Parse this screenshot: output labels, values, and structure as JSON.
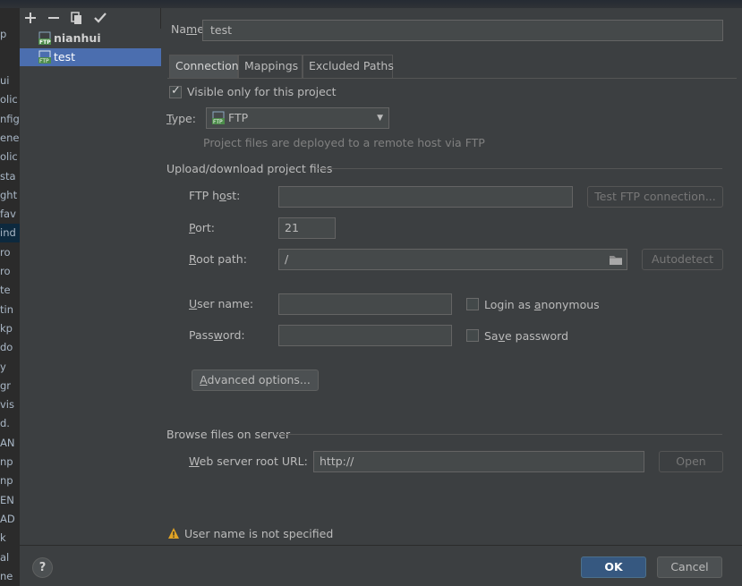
{
  "background_window": {
    "rows": [
      "p",
      "ui",
      "olic",
      "nfig",
      "ene",
      "olic",
      "sta",
      "ght",
      "fav",
      "ind",
      "ro",
      "ro",
      "te",
      "tin",
      "kp",
      "do",
      "y",
      "gr",
      "vis",
      "d.",
      "AN",
      "np",
      "np",
      "EN",
      "AD",
      "k",
      "al",
      "ne"
    ]
  },
  "toolbar": {
    "add_icon": "plus-icon",
    "remove_icon": "minus-icon",
    "copy_icon": "copy-icon",
    "default_icon": "check-icon"
  },
  "servers": [
    {
      "label": "nianhui",
      "icon": "ftp-icon"
    },
    {
      "label": "test",
      "icon": "ftp-icon"
    }
  ],
  "name": {
    "label_pre": "Na",
    "label_u": "m",
    "label_post": "e:",
    "value": "test"
  },
  "tabs": [
    {
      "label": "Connection"
    },
    {
      "label": "Mappings"
    },
    {
      "label": "Excluded Paths"
    }
  ],
  "connection": {
    "visible_only": {
      "label": "Visible only for this project",
      "checked": true
    },
    "type": {
      "label_u": "T",
      "label_post": "ype:",
      "value": "FTP",
      "hint": "Project files are deployed to a remote host via FTP"
    },
    "upload_section": "Upload/download project files",
    "ftp_host": {
      "label_pre": "FTP h",
      "label_u": "o",
      "label_post": "st:",
      "value": ""
    },
    "test_button": "Test FTP connection...",
    "port": {
      "label_u": "P",
      "label_post": "ort:",
      "value": "21"
    },
    "root_path": {
      "label_u": "R",
      "label_post": "oot path:",
      "value": "/"
    },
    "autodetect_button": "Autodetect",
    "user_name": {
      "label_u": "U",
      "label_post": "ser name:",
      "value": ""
    },
    "anonymous": {
      "label_pre": "Login as ",
      "label_u": "a",
      "label_post": "nonymous",
      "checked": false
    },
    "password": {
      "label_pre": "Pass",
      "label_u": "w",
      "label_post": "ord:",
      "value": ""
    },
    "save_password": {
      "label_pre": "Sa",
      "label_u": "v",
      "label_post": "e password",
      "checked": false
    },
    "advanced_button": {
      "label_u": "A",
      "label_post": "dvanced options..."
    },
    "browse_section": "Browse files on server",
    "web_root": {
      "label_u": "W",
      "label_post": "eb server root URL:",
      "value": "http://"
    },
    "open_button": "Open"
  },
  "warning": "User name is not specified",
  "footer": {
    "help": "?",
    "ok": "OK",
    "cancel": "Cancel"
  },
  "colors": {
    "selection": "#4b6eaf",
    "ok": "#365880",
    "warning": "#e0a325"
  }
}
